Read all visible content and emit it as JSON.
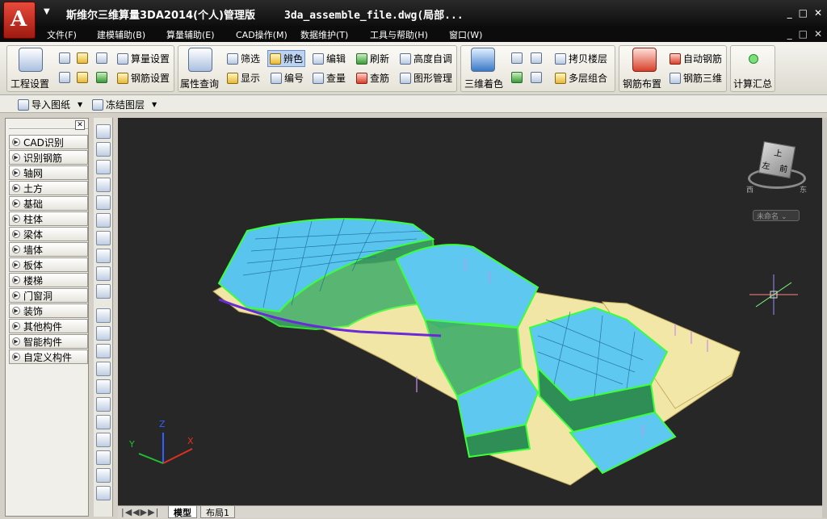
{
  "title": {
    "logo_letter": "A",
    "dropdown_glyph": "▼",
    "app": "斯维尔三维算量3DA2014(个人)管理版",
    "file": "3da_assemble_file.dwg(局部..."
  },
  "window_buttons": {
    "minimize": "_",
    "restore": "□",
    "close": "✕"
  },
  "doc_buttons": {
    "minimize": "_",
    "restore": "□",
    "close": "✕"
  },
  "menu": [
    "文件(F)",
    "建模辅助(B)",
    "算量辅助(E)",
    "CAD操作(M)",
    "数据维护(T)",
    "工具与帮助(H)",
    "窗口(W)"
  ],
  "toolbar": {
    "project_settings": "工程设置",
    "quantity_settings": "算量设置",
    "rebar_settings": "钢筋设置",
    "property_query": "属性查询",
    "filter": "筛选",
    "identify_color": "辨色",
    "edit": "编辑",
    "refresh": "刷新",
    "height_auto": "高度自调",
    "display": "显示",
    "numbering": "编号",
    "check_quantity": "查量",
    "check_rebar": "查筋",
    "graphic_manage": "图形管理",
    "color_3d": "三维着色",
    "copy_floor": "拷贝楼层",
    "multi_floor": "多层组合",
    "rebar_layout": "钢筋布置",
    "auto_rebar": "自动钢筋",
    "rebar_3d": "钢筋三维",
    "calc_summary": "计算汇总"
  },
  "toolbar2": {
    "import_drawing": "导入图纸",
    "freeze_layer": "冻结图层"
  },
  "left_panel": {
    "close": "✕",
    "items": [
      "CAD识别",
      "识别钢筋",
      "轴网",
      "土方",
      "基础",
      "柱体",
      "梁体",
      "墙体",
      "板体",
      "楼梯",
      "门窗洞",
      "装饰",
      "其他构件",
      "智能构件",
      "自定义构件"
    ]
  },
  "viewcube": {
    "top": "上",
    "left": "左",
    "front": "前",
    "west": "西",
    "east": "东",
    "named_view": "未命名"
  },
  "axes": {
    "x": "X",
    "y": "Y",
    "z": "Z"
  },
  "tabs": {
    "model": "模型",
    "layout1": "布局1",
    "nav": [
      "|◀",
      "◀",
      "▶",
      "▶|"
    ]
  },
  "colors": {
    "viewport_bg": "#272727",
    "building_top": "#5fc8f0",
    "building_edge": "#3cff3c",
    "slab": "#f2e6a6",
    "accent": "#c8281c"
  }
}
